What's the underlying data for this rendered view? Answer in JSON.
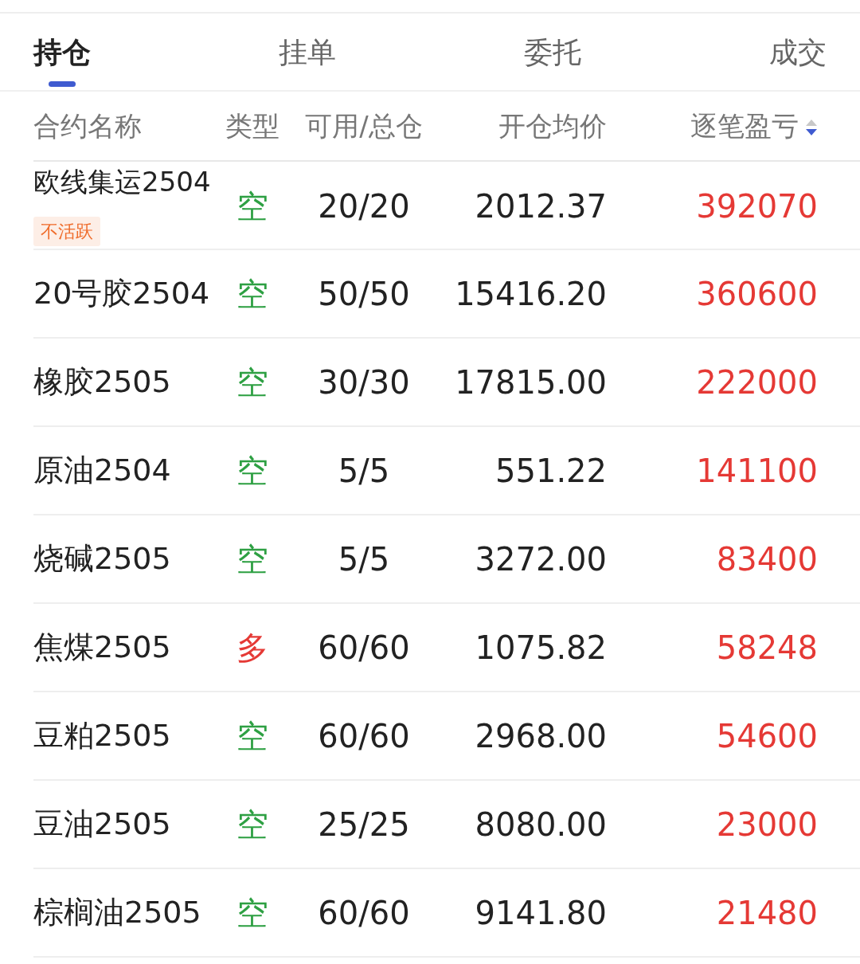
{
  "tabs": [
    {
      "label": "持仓",
      "selected": true
    },
    {
      "label": "挂单",
      "selected": false
    },
    {
      "label": "委托",
      "selected": false
    },
    {
      "label": "成交",
      "selected": false
    }
  ],
  "table": {
    "columns": [
      {
        "label": "合约名称",
        "sorted": false
      },
      {
        "label": "类型",
        "sorted": false
      },
      {
        "label": "可用/总仓",
        "sorted": false
      },
      {
        "label": "开仓均价",
        "sorted": false
      },
      {
        "label": "逐笔盈亏",
        "sorted": true,
        "descending": true
      }
    ],
    "rows": [
      {
        "name": "欧线集运2504",
        "tag": "不活跃",
        "type": "空",
        "kind": "short",
        "qty": "20/20",
        "price": "2012.37",
        "pnl": "392070"
      },
      {
        "name": "20号胶2504",
        "type": "空",
        "kind": "short",
        "qty": "50/50",
        "price": "15416.20",
        "pnl": "360600"
      },
      {
        "name": "橡胶2505",
        "type": "空",
        "kind": "short",
        "qty": "30/30",
        "price": "17815.00",
        "pnl": "222000"
      },
      {
        "name": "原油2504",
        "type": "空",
        "kind": "short",
        "qty": "5/5",
        "price": "551.22",
        "pnl": "141100"
      },
      {
        "name": "烧碱2505",
        "type": "空",
        "kind": "short",
        "qty": "5/5",
        "price": "3272.00",
        "pnl": "83400"
      },
      {
        "name": "焦煤2505",
        "type": "多",
        "kind": "long",
        "qty": "60/60",
        "price": "1075.82",
        "pnl": "58248"
      },
      {
        "name": "豆粕2505",
        "type": "空",
        "kind": "short",
        "qty": "60/60",
        "price": "2968.00",
        "pnl": "54600"
      },
      {
        "name": "豆油2505",
        "type": "空",
        "kind": "short",
        "qty": "25/25",
        "price": "8080.00",
        "pnl": "23000"
      },
      {
        "name": "棕榈油2505",
        "type": "空",
        "kind": "short",
        "qty": "60/60",
        "price": "9141.80",
        "pnl": "21480"
      }
    ]
  }
}
